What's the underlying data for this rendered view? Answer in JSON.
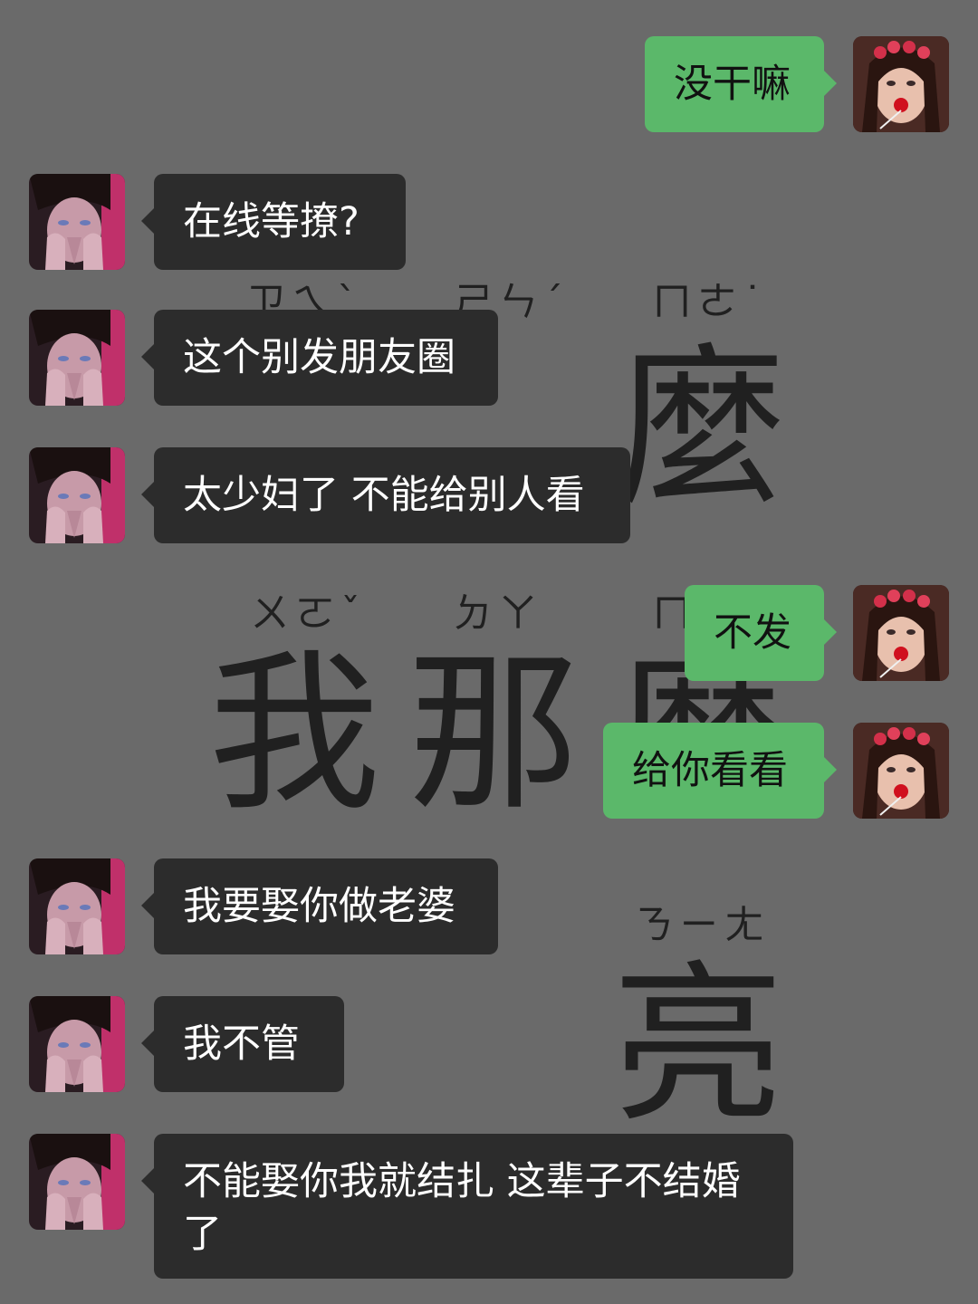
{
  "wallpaper": {
    "zhuyin": [
      "ㄗㄟˋ",
      "ㄕㄣˊ",
      "ㄇㄜ˙",
      "ㄨㄛˇ",
      "ㄉㄚ",
      "ㄇ",
      "ㄋㄧㄤ"
    ],
    "chars": [
      "麼",
      "我",
      "那",
      "麼",
      "亮"
    ]
  },
  "messages": [
    {
      "side": "out",
      "text": "没干嘛"
    },
    {
      "side": "in",
      "text": "在线等撩?"
    },
    {
      "side": "in",
      "text": "这个别发朋友圈"
    },
    {
      "side": "in",
      "text": "太少妇了 不能给别人看"
    },
    {
      "side": "out",
      "text": "不发"
    },
    {
      "side": "out",
      "text": "给你看看"
    },
    {
      "side": "in",
      "text": "我要娶你做老婆"
    },
    {
      "side": "in",
      "text": "我不管"
    },
    {
      "side": "in",
      "text": "不能娶你我就结扎 这辈子不结婚了"
    }
  ],
  "colors": {
    "incoming_bubble": "#2c2c2c",
    "outgoing_bubble": "#5bb86a",
    "background": "#6a6a6a"
  },
  "icons": {
    "incoming_avatar": "avatar-boy-icon",
    "outgoing_avatar": "avatar-girl-icon"
  }
}
